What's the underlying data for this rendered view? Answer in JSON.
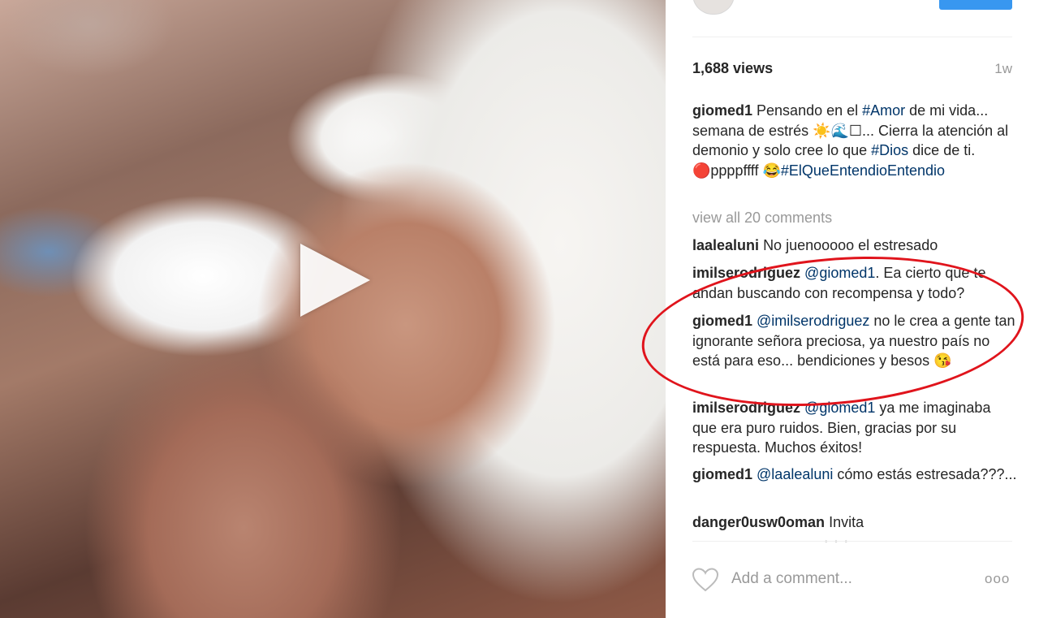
{
  "post": {
    "views": "1,688 views",
    "time": "1w",
    "caption": {
      "user": "giomed1",
      "parts": [
        {
          "t": "Pensando en el ",
          "tag": false
        },
        {
          "t": "#Amor",
          "tag": true
        },
        {
          "t": " de mi vida... semana de estrés ☀️🌊☐... Cierra la atención al demonio y solo cree lo que ",
          "tag": false
        },
        {
          "t": "#Dios",
          "tag": true
        },
        {
          "t": " dice de ti. 🔴ppppffff ",
          "tag": false
        },
        {
          "t": "😂",
          "tag": false
        },
        {
          "t": "#ElQueEntendioEntendio",
          "tag": true
        }
      ]
    },
    "view_all": "view all 20 comments",
    "comments": [
      {
        "user": "laalealuni",
        "mention": "",
        "text": "No juenooooo el estresado"
      },
      {
        "user": "imilserodriguez",
        "mention": "@giomed1",
        "text": ". Ea cierto que te andan buscando con recompensa y todo?"
      },
      {
        "user": "giomed1",
        "mention": "@imilserodriguez",
        "text": " no le crea a gente tan ignorante señora preciosa, ya nuestro país no está para eso... bendiciones y besos 😘"
      },
      {
        "user": "imilserodriguez",
        "mention": "@giomed1",
        "text": " ya me imaginaba que era puro ruidos. Bien, gracias por su respuesta. Muchos éxitos!"
      },
      {
        "user": "giomed1",
        "mention": "@laalealuni",
        "text": " cómo estás estresada???..."
      },
      {
        "user": "danger0usw0oman",
        "mention": "",
        "text": "Invita"
      }
    ],
    "add_comment_placeholder": "Add a comment...",
    "more_label": "ooo"
  },
  "colors": {
    "accent": "#3897f0",
    "annotation": "#e0141c",
    "hashtag": "#003569"
  },
  "icons": {
    "like": "heart-icon",
    "play": "play-icon",
    "more": "more-options-icon"
  }
}
